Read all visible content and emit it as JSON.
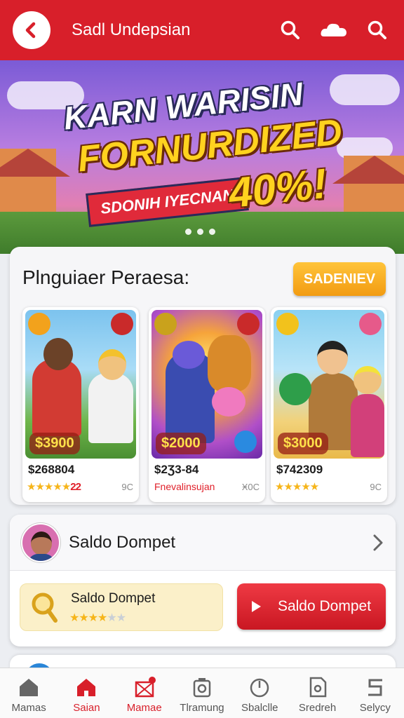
{
  "header": {
    "title": "Sadl Undepsian",
    "back_icon": "chevron-left-icon",
    "icons": [
      "search-icon",
      "cloud-icon",
      "search-icon"
    ]
  },
  "banner": {
    "line1": "KARN WARISIN",
    "line2": "FORNURDIZED",
    "badge": "SDONIH IYECNAN",
    "percent": "40%!",
    "slides": 3
  },
  "promo": {
    "title": "Plnguiaer Peraesa:",
    "button_label": "SADENIEV",
    "games": [
      {
        "art_price": "$3900",
        "price": "$268804",
        "rating_text": "22",
        "meta": "9C"
      },
      {
        "art_price": "$2000",
        "price": "$2Ʒ3-84",
        "subtitle": "Fnevalinsujan",
        "meta": "Ӿ0C"
      },
      {
        "art_price": "$3000",
        "price": "$742309",
        "meta": "9C"
      }
    ]
  },
  "wallet": {
    "title": "Saldo Dompet",
    "balance_label": "Saldo Dompet",
    "button_label": "Saldo Dompet"
  },
  "nav": {
    "items": [
      {
        "label": "Mamas",
        "icon": "home-icon"
      },
      {
        "label": "Saian",
        "icon": "home-icon"
      },
      {
        "label": "Mamae",
        "icon": "gift-icon"
      },
      {
        "label": "Tlramung",
        "icon": "camera-icon"
      },
      {
        "label": "Sbalclle",
        "icon": "power-icon"
      },
      {
        "label": "Sredreh",
        "icon": "document-icon"
      },
      {
        "label": "Selycy",
        "icon": "s-icon"
      }
    ],
    "active_index": 1
  },
  "colors": {
    "brand_red": "#d81f2a",
    "accent_orange": "#f29b12",
    "star_gold": "#f6b51a"
  }
}
